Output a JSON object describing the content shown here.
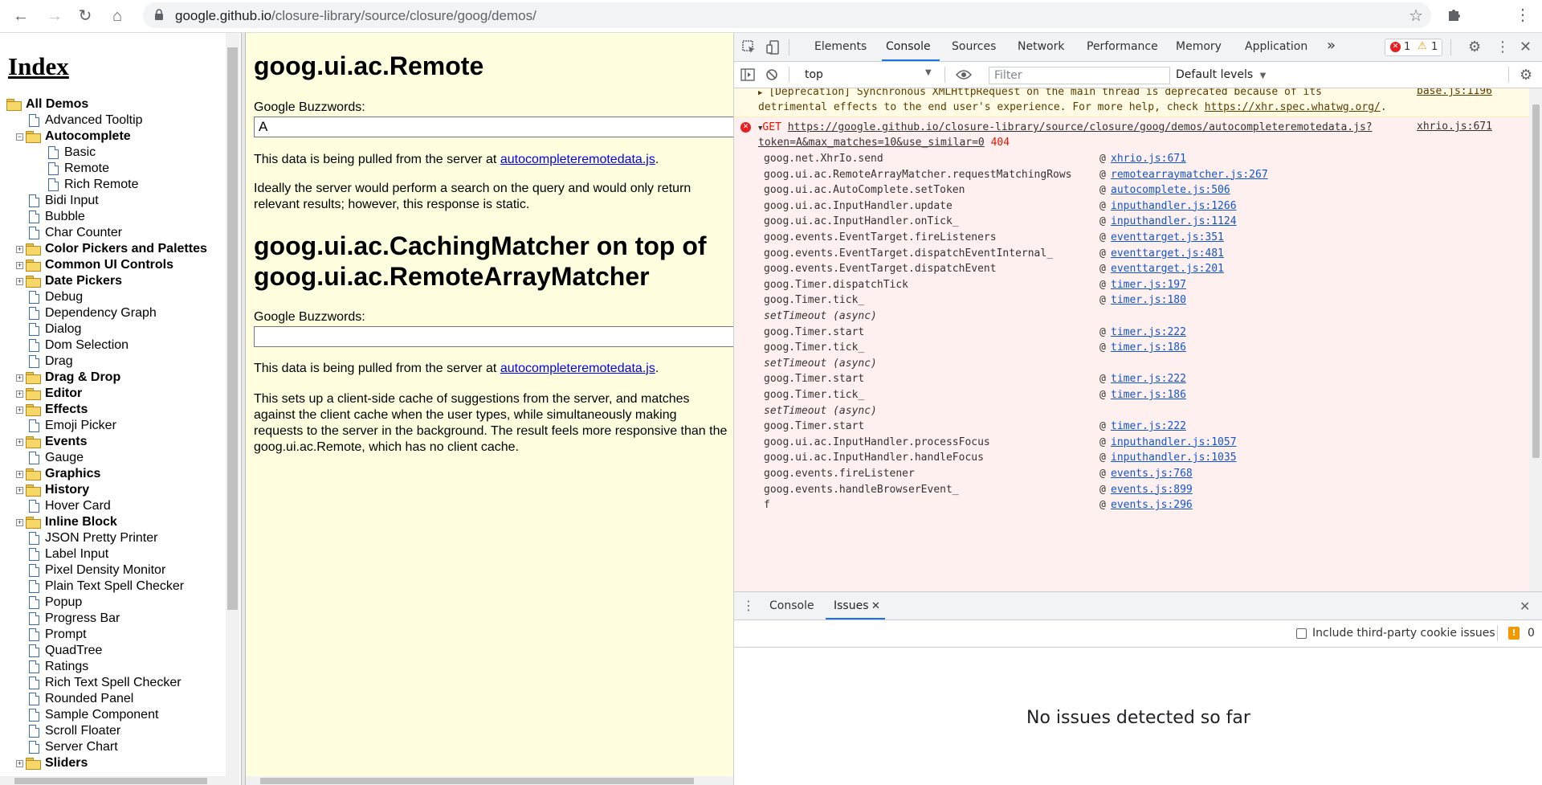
{
  "browser": {
    "url_host": "google.github.io",
    "url_path": "/closure-library/source/closure/goog/demos/"
  },
  "index": {
    "title": "Index",
    "items": [
      {
        "label": "All Demos",
        "type": "folder",
        "level": 0,
        "expander": false
      },
      {
        "label": "Advanced Tooltip",
        "type": "doc",
        "level": 1
      },
      {
        "label": "Autocomplete",
        "type": "folder",
        "level": 1,
        "expander": "minus"
      },
      {
        "label": "Basic",
        "type": "doc",
        "level": 2
      },
      {
        "label": "Remote",
        "type": "doc",
        "level": 2
      },
      {
        "label": "Rich Remote",
        "type": "doc",
        "level": 2
      },
      {
        "label": "Bidi Input",
        "type": "doc",
        "level": 1
      },
      {
        "label": "Bubble",
        "type": "doc",
        "level": 1
      },
      {
        "label": "Char Counter",
        "type": "doc",
        "level": 1
      },
      {
        "label": "Color Pickers and Palettes",
        "type": "folder",
        "level": 1,
        "expander": "plus"
      },
      {
        "label": "Common UI Controls",
        "type": "folder",
        "level": 1,
        "expander": "plus"
      },
      {
        "label": "Date Pickers",
        "type": "folder",
        "level": 1,
        "expander": "plus"
      },
      {
        "label": "Debug",
        "type": "doc",
        "level": 1
      },
      {
        "label": "Dependency Graph",
        "type": "doc",
        "level": 1
      },
      {
        "label": "Dialog",
        "type": "doc",
        "level": 1
      },
      {
        "label": "Dom Selection",
        "type": "doc",
        "level": 1
      },
      {
        "label": "Drag",
        "type": "doc",
        "level": 1
      },
      {
        "label": "Drag & Drop",
        "type": "folder",
        "level": 1,
        "expander": "plus"
      },
      {
        "label": "Editor",
        "type": "folder",
        "level": 1,
        "expander": "plus"
      },
      {
        "label": "Effects",
        "type": "folder",
        "level": 1,
        "expander": "plus"
      },
      {
        "label": "Emoji Picker",
        "type": "doc",
        "level": 1
      },
      {
        "label": "Events",
        "type": "folder",
        "level": 1,
        "expander": "plus"
      },
      {
        "label": "Gauge",
        "type": "doc",
        "level": 1
      },
      {
        "label": "Graphics",
        "type": "folder",
        "level": 1,
        "expander": "plus"
      },
      {
        "label": "History",
        "type": "folder",
        "level": 1,
        "expander": "plus"
      },
      {
        "label": "Hover Card",
        "type": "doc",
        "level": 1
      },
      {
        "label": "Inline Block",
        "type": "folder",
        "level": 1,
        "expander": "plus"
      },
      {
        "label": "JSON Pretty Printer",
        "type": "doc",
        "level": 1
      },
      {
        "label": "Label Input",
        "type": "doc",
        "level": 1
      },
      {
        "label": "Pixel Density Monitor",
        "type": "doc",
        "level": 1
      },
      {
        "label": "Plain Text Spell Checker",
        "type": "doc",
        "level": 1
      },
      {
        "label": "Popup",
        "type": "doc",
        "level": 1
      },
      {
        "label": "Progress Bar",
        "type": "doc",
        "level": 1
      },
      {
        "label": "Prompt",
        "type": "doc",
        "level": 1
      },
      {
        "label": "QuadTree",
        "type": "doc",
        "level": 1
      },
      {
        "label": "Ratings",
        "type": "doc",
        "level": 1
      },
      {
        "label": "Rich Text Spell Checker",
        "type": "doc",
        "level": 1
      },
      {
        "label": "Rounded Panel",
        "type": "doc",
        "level": 1
      },
      {
        "label": "Sample Component",
        "type": "doc",
        "level": 1
      },
      {
        "label": "Scroll Floater",
        "type": "doc",
        "level": 1
      },
      {
        "label": "Server Chart",
        "type": "doc",
        "level": 1
      },
      {
        "label": "Sliders",
        "type": "folder",
        "level": 1,
        "expander": "plus"
      }
    ]
  },
  "demo": {
    "heading1": "goog.ui.ac.Remote",
    "label1": "Google Buzzwords:",
    "input1_value": "A",
    "p1_prefix": "This data is being pulled from the server at ",
    "p1_link": "autocompleteremotedata.js",
    "p1_suffix": ".",
    "p2": "Ideally the server would perform a search on the query and would only return relevant results; however, this response is static.",
    "heading2": "goog.ui.ac.CachingMatcher on top of goog.ui.ac.RemoteArrayMatcher",
    "label2": "Google Buzzwords:",
    "input2_value": "",
    "p3_prefix": "This data is being pulled from the server at ",
    "p3_link": "autocompleteremotedata.js",
    "p3_suffix": ".",
    "p4": "This sets up a client-side cache of suggestions from the server, and matches against the client cache when the user types, while simultaneously making requests to the server in the background. The result feels more responsive than the goog.ui.ac.Remote, which has no client cache."
  },
  "devtools": {
    "tabs": [
      "Elements",
      "Console",
      "Sources",
      "Network",
      "Performance",
      "Memory",
      "Application"
    ],
    "active_tab": "Console",
    "more_tabs": "»",
    "error_count": "1",
    "warning_count": "1",
    "context": "top",
    "filter_placeholder": "Filter",
    "levels": "Default levels",
    "warning": {
      "text_line1": "[Deprecation] Synchronous XMLHttpRequest on the main thread is deprecated because of its",
      "text_line2_prefix": "detrimental effects to the end user's experience. For more help, check ",
      "link": "https://xhr.spec.whatwg.org/",
      "text_line2_suffix": ".",
      "source": "base.js:1196"
    },
    "error": {
      "method": "GET",
      "url_line1": "https://google.github.io/closure-library/source/closure/goog/demos/autocompleteremotedata.js?",
      "url_line2": "token=A&max_matches=10&use_similar=0",
      "status": "404",
      "source": "xhrio.js:671"
    },
    "stack": [
      {
        "fn": "goog.net.XhrIo.send",
        "loc": "xhrio.js:671"
      },
      {
        "fn": "goog.ui.ac.RemoteArrayMatcher.requestMatchingRows",
        "loc": "remotearraymatcher.js:267"
      },
      {
        "fn": "goog.ui.ac.AutoComplete.setToken",
        "loc": "autocomplete.js:506"
      },
      {
        "fn": "goog.ui.ac.InputHandler.update",
        "loc": "inputhandler.js:1266"
      },
      {
        "fn": "goog.ui.ac.InputHandler.onTick_",
        "loc": "inputhandler.js:1124"
      },
      {
        "fn": "goog.events.EventTarget.fireListeners",
        "loc": "eventtarget.js:351"
      },
      {
        "fn": "goog.events.EventTarget.dispatchEventInternal_",
        "loc": "eventtarget.js:481"
      },
      {
        "fn": "goog.events.EventTarget.dispatchEvent",
        "loc": "eventtarget.js:201"
      },
      {
        "fn": "goog.Timer.dispatchTick",
        "loc": "timer.js:197"
      },
      {
        "fn": "goog.Timer.tick_",
        "loc": "timer.js:180"
      },
      {
        "fn": "setTimeout (async)",
        "loc": "",
        "async": true
      },
      {
        "fn": "goog.Timer.start",
        "loc": "timer.js:222"
      },
      {
        "fn": "goog.Timer.tick_",
        "loc": "timer.js:186"
      },
      {
        "fn": "setTimeout (async)",
        "loc": "",
        "async": true
      },
      {
        "fn": "goog.Timer.start",
        "loc": "timer.js:222"
      },
      {
        "fn": "goog.Timer.tick_",
        "loc": "timer.js:186"
      },
      {
        "fn": "setTimeout (async)",
        "loc": "",
        "async": true
      },
      {
        "fn": "goog.Timer.start",
        "loc": "timer.js:222"
      },
      {
        "fn": "goog.ui.ac.InputHandler.processFocus",
        "loc": "inputhandler.js:1057"
      },
      {
        "fn": "goog.ui.ac.InputHandler.handleFocus",
        "loc": "inputhandler.js:1035"
      },
      {
        "fn": "goog.events.fireListener",
        "loc": "events.js:768"
      },
      {
        "fn": "goog.events.handleBrowserEvent_",
        "loc": "events.js:899"
      },
      {
        "fn": "f",
        "loc": "events.js:296"
      }
    ],
    "drawer_tabs": [
      "Console",
      "Issues"
    ],
    "drawer_active": "Issues",
    "cookie_label": "Include third-party cookie issues",
    "issues_count": "0",
    "no_issues": "No issues detected so far"
  }
}
